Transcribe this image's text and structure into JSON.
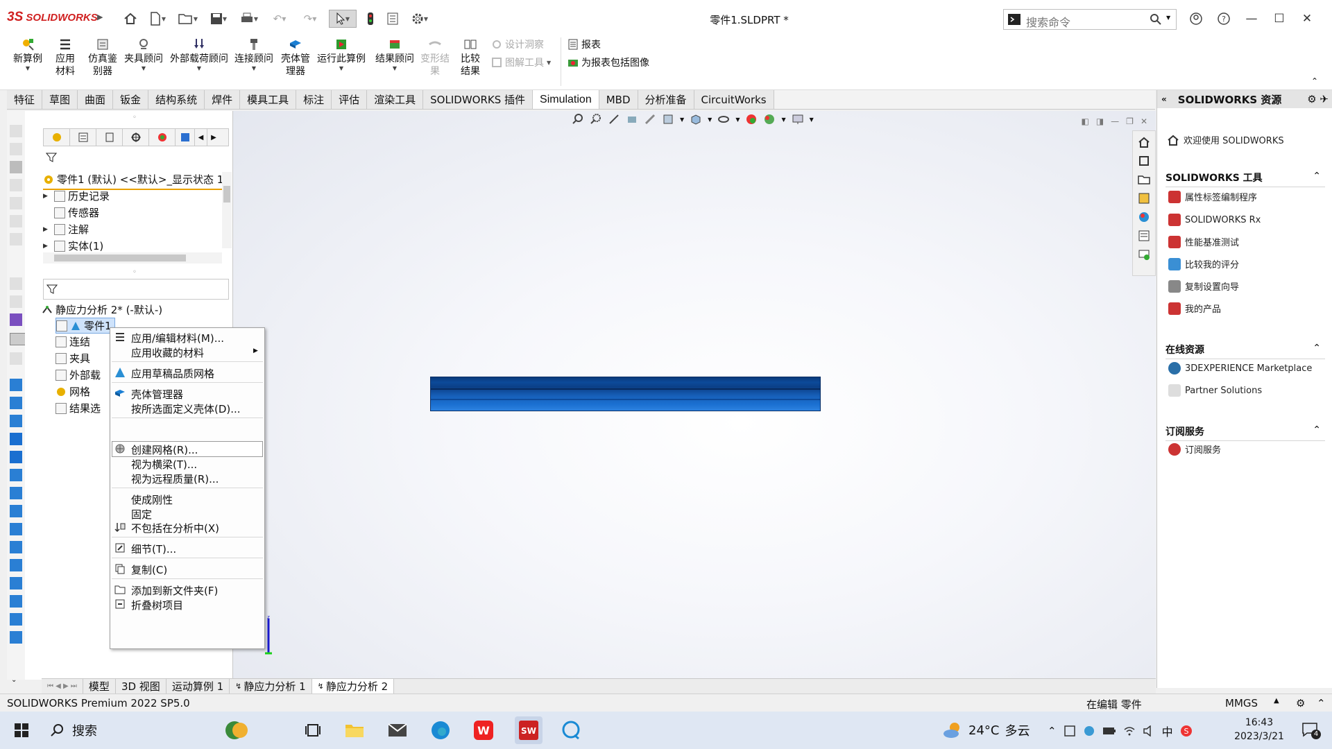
{
  "app": {
    "logo_prefix": "3S",
    "logo_text": "SOLIDWORKS",
    "doc_title": "零件1.SLDPRT *"
  },
  "search": {
    "placeholder": "搜索命令"
  },
  "ribbon": {
    "new_study": "新算例",
    "apply_material": "应用材料",
    "sim_advisor": "仿真鉴别器",
    "fixture_advisor": "夹具顾问",
    "external_loads": "外部载荷顾问",
    "connections_advisor": "连接顾问",
    "shell_manager": "壳体管理器",
    "run_study": "运行此算例",
    "results_advisor": "结果顾问",
    "deformed_result": "变形结果",
    "compare_results": "比较结果",
    "design_insight": "设计洞察",
    "plot_tools": "图解工具",
    "report": "报表",
    "include_image": "为报表包括图像"
  },
  "tabs": [
    "特征",
    "草图",
    "曲面",
    "钣金",
    "结构系统",
    "焊件",
    "模具工具",
    "标注",
    "评估",
    "渲染工具",
    "SOLIDWORKS 插件",
    "Simulation",
    "MBD",
    "分析准备",
    "CircuitWorks"
  ],
  "active_tab": "Simulation",
  "tree": {
    "root": "零件1 (默认) <<默认>_显示状态 1",
    "items": [
      "历史记录",
      "传感器",
      "注解",
      "实体(1)"
    ],
    "study": "静应力分析 2* (-默认-)",
    "study_items": [
      "零件1",
      "连结",
      "夹具",
      "外部载",
      "网格",
      "结果选"
    ]
  },
  "context_menu": {
    "items": [
      "应用/编辑材料(M)...",
      "应用收藏的材料",
      "应用草稿品质网格",
      "壳体管理器",
      "按所选面定义壳体(D)...",
      "创建网格(R)...",
      "视为横梁(T)...",
      "视为远程质量(R)...",
      "使成刚性",
      "固定",
      "不包括在分析中(X)",
      "细节(T)...",
      "复制(C)",
      "添加到新文件夹(F)",
      "折叠树项目"
    ]
  },
  "bottom_tabs": [
    "模型",
    "3D 视图",
    "运动算例 1",
    "静应力分析 1",
    "静应力分析 2"
  ],
  "status": {
    "product": "SOLIDWORKS Premium 2022 SP5.0",
    "editing": "在编辑 零件",
    "units": "MMGS"
  },
  "task_pane": {
    "title": "SOLIDWORKS 资源",
    "welcome": "欢迎使用  SOLIDWORKS",
    "tools_header": "SOLIDWORKS 工具",
    "tools": [
      "属性标签编制程序",
      "SOLIDWORKS Rx",
      "性能基准测试",
      "比较我的评分",
      "复制设置向导",
      "我的产品"
    ],
    "online_header": "在线资源",
    "online": [
      "3DEXPERIENCE Marketplace",
      "Partner Solutions"
    ],
    "subs_header": "订阅服务",
    "subs": [
      "订阅服务"
    ]
  },
  "taskbar": {
    "search": "搜索",
    "weather_temp": "24°C",
    "weather_desc": "多云",
    "ime": "中",
    "time": "16:43",
    "date": "2023/3/21",
    "notif": "4"
  },
  "colors": {
    "accent": "#d02020",
    "part_blue": "#1a6fd0",
    "taskbar": "#dfe7f3"
  }
}
